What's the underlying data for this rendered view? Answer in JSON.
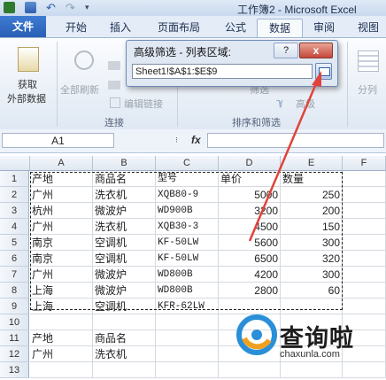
{
  "window": {
    "title": "工作簿2 - Microsoft Excel"
  },
  "tabs": [
    {
      "name": "tab-file",
      "label": "文件"
    },
    {
      "name": "tab-home",
      "label": "开始"
    },
    {
      "name": "tab-insert",
      "label": "插入"
    },
    {
      "name": "tab-page-layout",
      "label": "页面布局"
    },
    {
      "name": "tab-formulas",
      "label": "公式"
    },
    {
      "name": "tab-data",
      "label": "数据"
    },
    {
      "name": "tab-review",
      "label": "审阅"
    },
    {
      "name": "tab-view",
      "label": "视图"
    }
  ],
  "ribbon": {
    "get_external_1": "获取",
    "get_external_2": "外部数据",
    "refresh_all": "全部刷新",
    "edit_links": "编辑链接",
    "connections_group": "连接",
    "filter_cut": "筛选",
    "advanced": "高级",
    "sort_filter_group": "排序和筛选",
    "split": "分列"
  },
  "dialog": {
    "title": "高级筛选 - 列表区域:",
    "help": "?",
    "close": "x",
    "input_value": "Sheet1!$A$1:$E$9"
  },
  "formula_bar": {
    "name_box": "A1",
    "fx": "fx"
  },
  "columns": [
    "A",
    "B",
    "C",
    "D",
    "E",
    "F"
  ],
  "rows": [
    "1",
    "2",
    "3",
    "4",
    "5",
    "6",
    "7",
    "8",
    "9",
    "10",
    "11",
    "12",
    "13"
  ],
  "table": [
    [
      "产地",
      "商品名",
      "型号",
      "单价",
      "数量"
    ],
    [
      "广州",
      "洗衣机",
      "XQB80-9",
      "5000",
      "250"
    ],
    [
      "杭州",
      "微波炉",
      "WD900B",
      "3200",
      "200"
    ],
    [
      "广州",
      "洗衣机",
      "XQB30-3",
      "4500",
      "150"
    ],
    [
      "南京",
      "空调机",
      "KF-50LW",
      "5600",
      "300"
    ],
    [
      "南京",
      "空调机",
      "KF-50LW",
      "6500",
      "320"
    ],
    [
      "广州",
      "微波炉",
      "WD800B",
      "4200",
      "300"
    ],
    [
      "上海",
      "微波炉",
      "WD800B",
      "2800",
      "60"
    ],
    [
      "上海",
      "空调机",
      "KFR-62LW",
      "",
      ""
    ]
  ],
  "criteria": [
    [
      "产地",
      "商品名"
    ],
    [
      "广州",
      "洗衣机"
    ]
  ],
  "watermark": {
    "text": "查询啦",
    "url": "chaxunla.com"
  },
  "colors": {
    "accent": "#2a5fb5",
    "arrow": "#e0433a"
  }
}
